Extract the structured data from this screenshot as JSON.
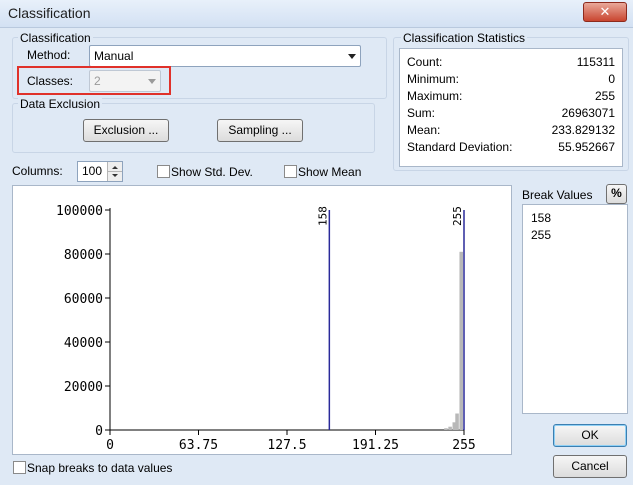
{
  "window": {
    "title": "Classification",
    "close_glyph": "✕"
  },
  "classification": {
    "group_label": "Classification",
    "method_label": "Method:",
    "method_value": "Manual",
    "classes_label": "Classes:",
    "classes_value": "2"
  },
  "exclusion": {
    "group_label": "Data Exclusion",
    "exclusion_button": "Exclusion ...",
    "sampling_button": "Sampling ..."
  },
  "statistics": {
    "title": "Classification Statistics",
    "rows": [
      {
        "label": "Count:",
        "value": "115311"
      },
      {
        "label": "Minimum:",
        "value": "0"
      },
      {
        "label": "Maximum:",
        "value": "255"
      },
      {
        "label": "Sum:",
        "value": "26963071"
      },
      {
        "label": "Mean:",
        "value": "233.829132"
      },
      {
        "label": "Standard Deviation:",
        "value": "55.952667"
      }
    ]
  },
  "histogram_options": {
    "columns_label": "Columns:",
    "columns_value": "100",
    "show_std_label": "Show Std. Dev.",
    "show_mean_label": "Show Mean"
  },
  "histogram": {
    "x_ticks": [
      "0",
      "63.75",
      "127.5",
      "191.25",
      "255"
    ],
    "y_ticks": [
      "0",
      "20000",
      "40000",
      "60000",
      "80000",
      "100000"
    ],
    "x_range": [
      0,
      255
    ],
    "y_range": [
      0,
      100000
    ],
    "break_values": [
      158,
      255
    ],
    "break_labels": [
      "158",
      "255"
    ],
    "bars": [
      {
        "x": 242,
        "y": 800
      },
      {
        "x": 245,
        "y": 1500
      },
      {
        "x": 248,
        "y": 3500
      },
      {
        "x": 250,
        "y": 7500
      },
      {
        "x": 253,
        "y": 81000
      }
    ],
    "bar_color": "#b8b8b8",
    "break_color": "#2a2a9a"
  },
  "break_values_panel": {
    "title": "Break Values",
    "percent_button": "%",
    "items": [
      "158",
      "255"
    ]
  },
  "footer": {
    "snap_label": "Snap breaks to data values",
    "ok_button": "OK",
    "cancel_button": "Cancel"
  }
}
